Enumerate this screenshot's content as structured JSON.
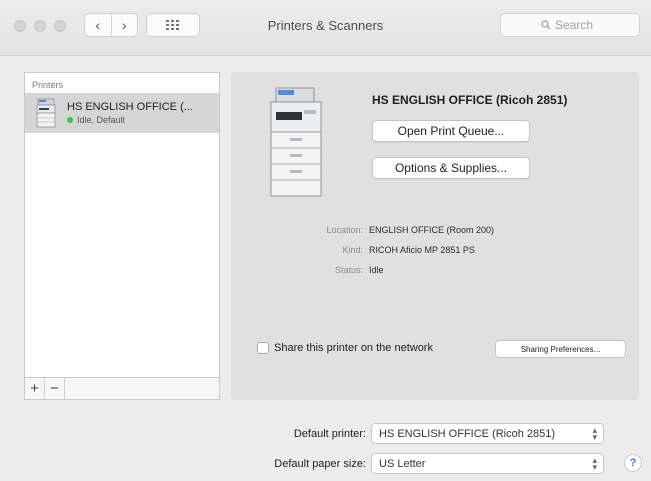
{
  "window": {
    "title": "Printers & Scanners",
    "search_placeholder": "Search",
    "icons": [
      "back-icon",
      "forward-icon",
      "grid-icon",
      "search-icon"
    ]
  },
  "printer_list": {
    "header": "Printers",
    "items": [
      {
        "name": "HS ENGLISH OFFICE (...",
        "status": "Idle, Default",
        "status_color": "#3fc24a"
      }
    ],
    "add_label": "+",
    "remove_label": "−"
  },
  "detail": {
    "printer_name": "HS ENGLISH OFFICE (Ricoh 2851)",
    "open_queue_label": "Open Print Queue...",
    "options_label": "Options & Supplies...",
    "location_label": "Location:",
    "location_value": "ENGLISH OFFICE (Room 200)",
    "kind_label": "Kind:",
    "kind_value": "RICOH Aficio MP 2851 PS",
    "status_label": "Status:",
    "status_value": "Idle",
    "share_label": "Share this printer on the network",
    "share_checked": false,
    "sharing_prefs_label": "Sharing Preferences..."
  },
  "defaults": {
    "printer_label": "Default printer:",
    "printer_value": "HS ENGLISH OFFICE (Ricoh 2851)",
    "paper_label": "Default paper size:",
    "paper_value": "US Letter"
  },
  "help_label": "?"
}
